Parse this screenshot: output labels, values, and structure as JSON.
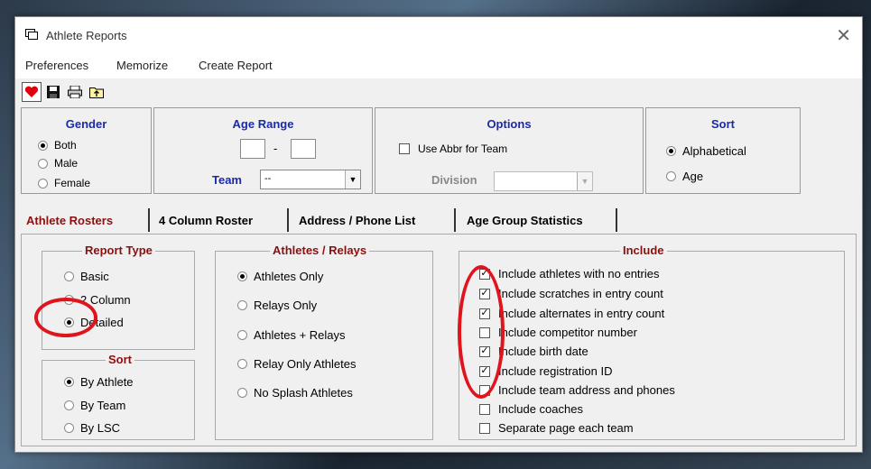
{
  "window": {
    "title": "Athlete Reports",
    "close": "✕"
  },
  "menu": [
    "Preferences",
    "Memorize",
    "Create Report"
  ],
  "gender": {
    "title": "Gender",
    "options": [
      {
        "label": "Both",
        "selected": true
      },
      {
        "label": "Male",
        "selected": false
      },
      {
        "label": "Female",
        "selected": false
      }
    ]
  },
  "age_range": {
    "title": "Age Range",
    "separator": "-",
    "team_label": "Team",
    "team_value": "--"
  },
  "options": {
    "title": "Options",
    "abbr_label": "Use Abbr for Team",
    "abbr_checked": false,
    "division_label": "Division",
    "division_value": ""
  },
  "sort_top": {
    "title": "Sort",
    "options": [
      {
        "label": "Alphabetical",
        "selected": true
      },
      {
        "label": "Age",
        "selected": false
      }
    ]
  },
  "tabs": [
    {
      "label": "Athlete Rosters",
      "selected": true
    },
    {
      "label": "4 Column Roster",
      "selected": false
    },
    {
      "label": "Address / Phone List",
      "selected": false
    },
    {
      "label": "Age Group Statistics",
      "selected": false
    }
  ],
  "report_type": {
    "title": "Report Type",
    "options": [
      {
        "label": "Basic",
        "selected": false
      },
      {
        "label": "2 Column",
        "selected": false
      },
      {
        "label": "Detailed",
        "selected": true
      }
    ]
  },
  "sort": {
    "title": "Sort",
    "options": [
      {
        "label": "By Athlete",
        "selected": true
      },
      {
        "label": "By Team",
        "selected": false
      },
      {
        "label": "By LSC",
        "selected": false
      }
    ]
  },
  "athletes_relays": {
    "title": "Athletes / Relays",
    "options": [
      {
        "label": "Athletes Only",
        "selected": true
      },
      {
        "label": "Relays Only",
        "selected": false
      },
      {
        "label": "Athletes + Relays",
        "selected": false
      },
      {
        "label": "Relay Only Athletes",
        "selected": false
      },
      {
        "label": "No Splash Athletes",
        "selected": false
      }
    ]
  },
  "include": {
    "title": "Include",
    "items": [
      {
        "label": "Include athletes with no entries",
        "checked": true
      },
      {
        "label": "Include scratches in entry count",
        "checked": true
      },
      {
        "label": "Include alternates in entry count",
        "checked": true
      },
      {
        "label": "Include competitor number",
        "checked": false
      },
      {
        "label": "Include birth date",
        "checked": true
      },
      {
        "label": "Include registration ID",
        "checked": true
      },
      {
        "label": "Include team address and phones",
        "checked": false
      },
      {
        "label": "Include coaches",
        "checked": false
      },
      {
        "label": "Separate page each team",
        "checked": false
      }
    ]
  },
  "colors": {
    "heading_blue": "#1a2aaa",
    "heading_red": "#8a1010",
    "annotation": "#e0141c"
  }
}
